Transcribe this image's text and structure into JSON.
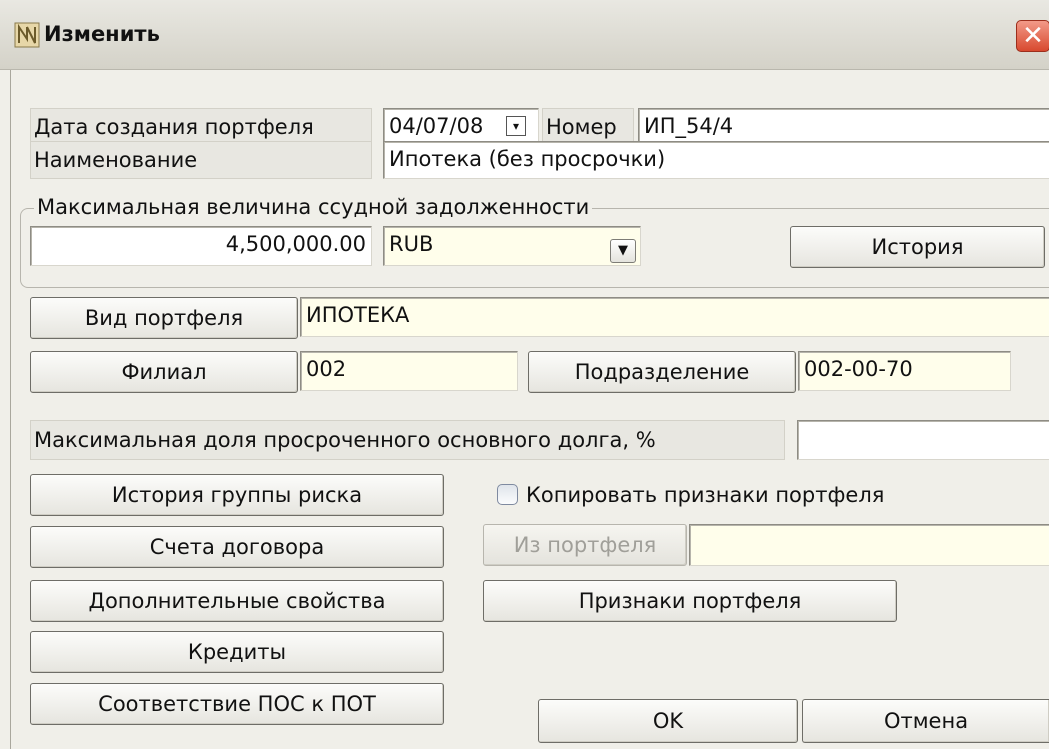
{
  "window": {
    "title": "Изменить",
    "close_glyph": "✕",
    "icon": "app-icon"
  },
  "fields": {
    "creation_date_label": "Дата создания портфеля",
    "creation_date_value": "04/07/08",
    "number_label": "Номер",
    "number_value": "ИП_54/4",
    "name_label": "Наименование",
    "name_value": "Ипотека (без просрочки)"
  },
  "debt_group": {
    "legend": "Максимальная величина ссудной задолженности",
    "amount": "4,500,000.00",
    "currency": "RUB",
    "history_button": "История"
  },
  "portfolio": {
    "type_button": "Вид портфеля",
    "type_value": "ИПОТЕКА",
    "branch_button": "Филиал",
    "branch_value": "002",
    "division_button": "Подразделение",
    "division_value": "002-00-70"
  },
  "overdue": {
    "label": "Максимальная доля просроченного основного долга, %",
    "value": ""
  },
  "left_buttons": {
    "risk_history": "История группы риска",
    "contract_accounts": "Счета договора",
    "extra_props": "Дополнительные свойства",
    "credits": "Кредиты",
    "pos_pot": "Соответствие ПОС к ПОТ"
  },
  "copy_section": {
    "checkbox_label": "Копировать признаки портфеля",
    "checked": false,
    "from_portfolio_button": "Из портфеля",
    "from_portfolio_value": "",
    "features_button": "Признаки портфеля"
  },
  "footer": {
    "ok": "OK",
    "cancel": "Отмена"
  }
}
